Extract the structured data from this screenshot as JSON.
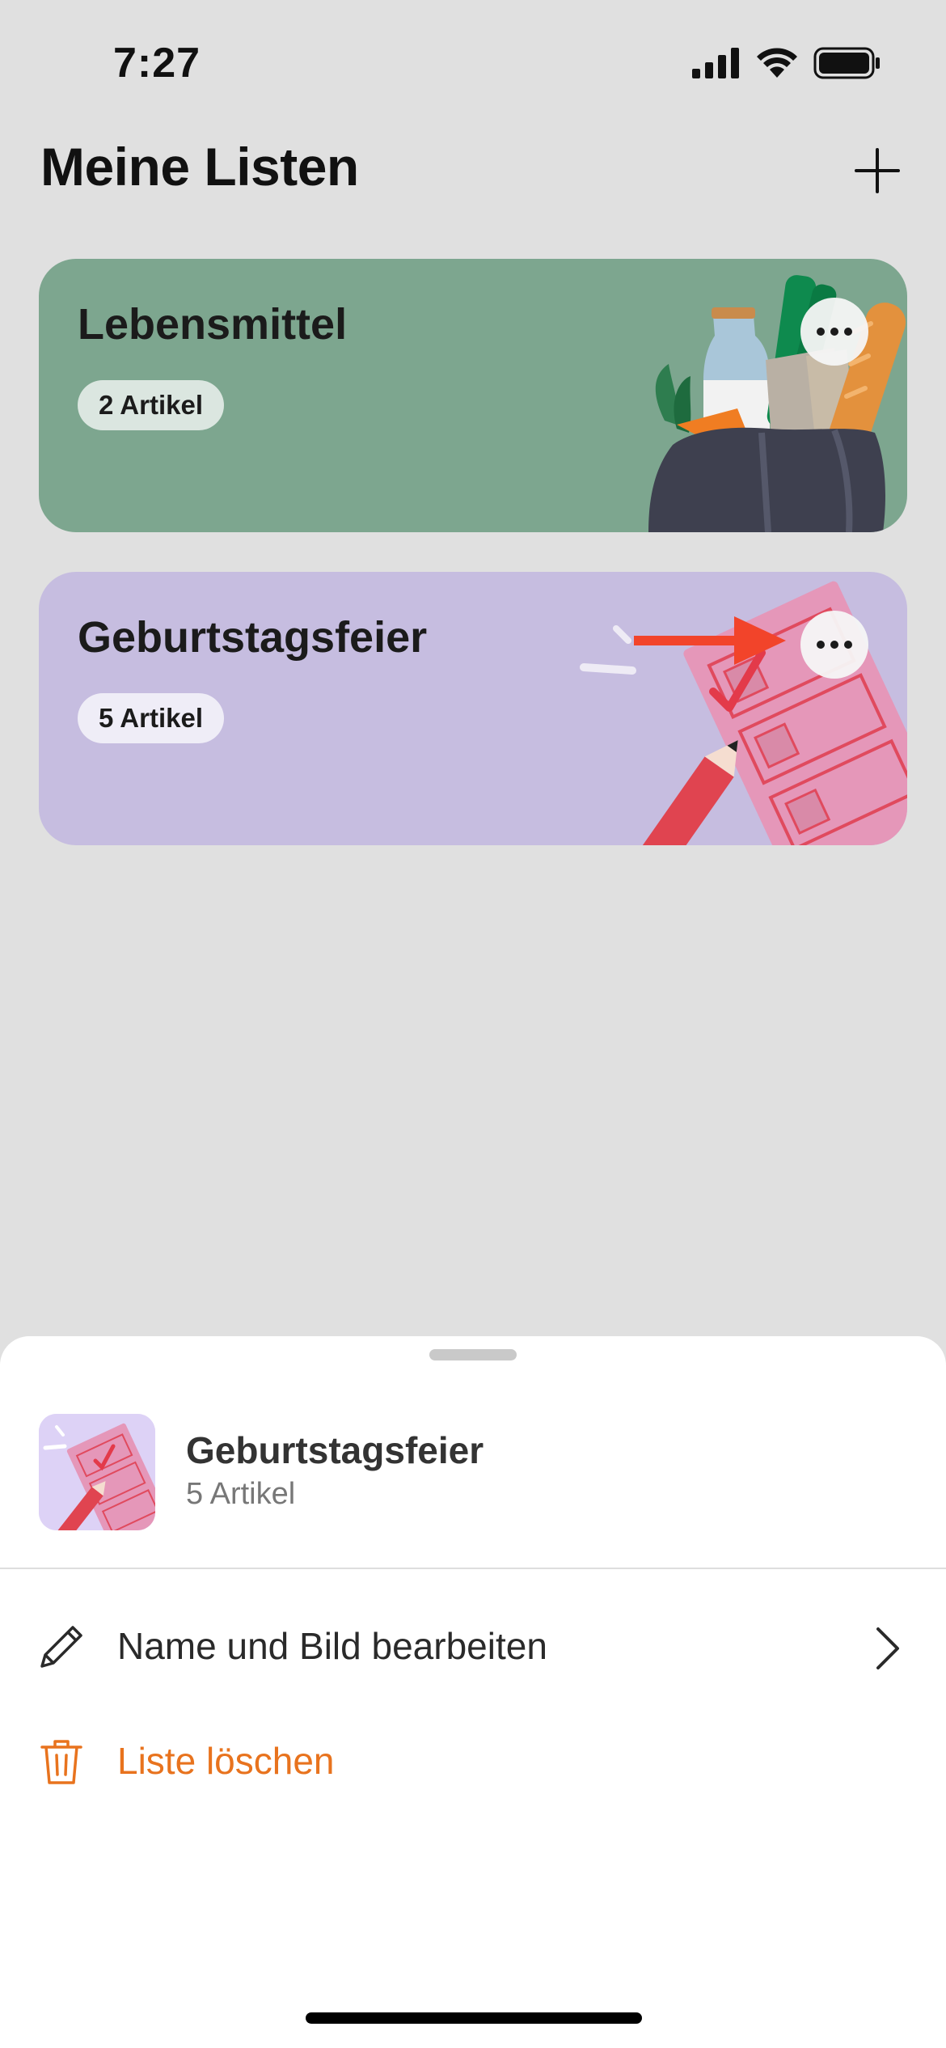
{
  "status_bar": {
    "time": "7:27"
  },
  "header": {
    "title": "Meine Listen",
    "add_icon": "plus-icon"
  },
  "lists": [
    {
      "title": "Lebensmittel",
      "badge": "2 Artikel",
      "color": "#7da68f",
      "illustration": "grocery-bag-illustration"
    },
    {
      "title": "Geburtstagsfeier",
      "badge": "5 Artikel",
      "color": "#c6bde0",
      "illustration": "checklist-illustration"
    }
  ],
  "sheet": {
    "title": "Geburtstagsfeier",
    "subtitle": "5 Artikel",
    "items": [
      {
        "label": "Name und Bild bearbeiten",
        "icon": "pencil-icon",
        "color": "#2a2a2a"
      },
      {
        "label": "Liste löschen",
        "icon": "trash-icon",
        "color": "#e8731e"
      }
    ]
  },
  "colors": {
    "background": "#e0e0e0",
    "accent_destructive": "#e8731e",
    "annotation_arrow": "#f2442a"
  }
}
